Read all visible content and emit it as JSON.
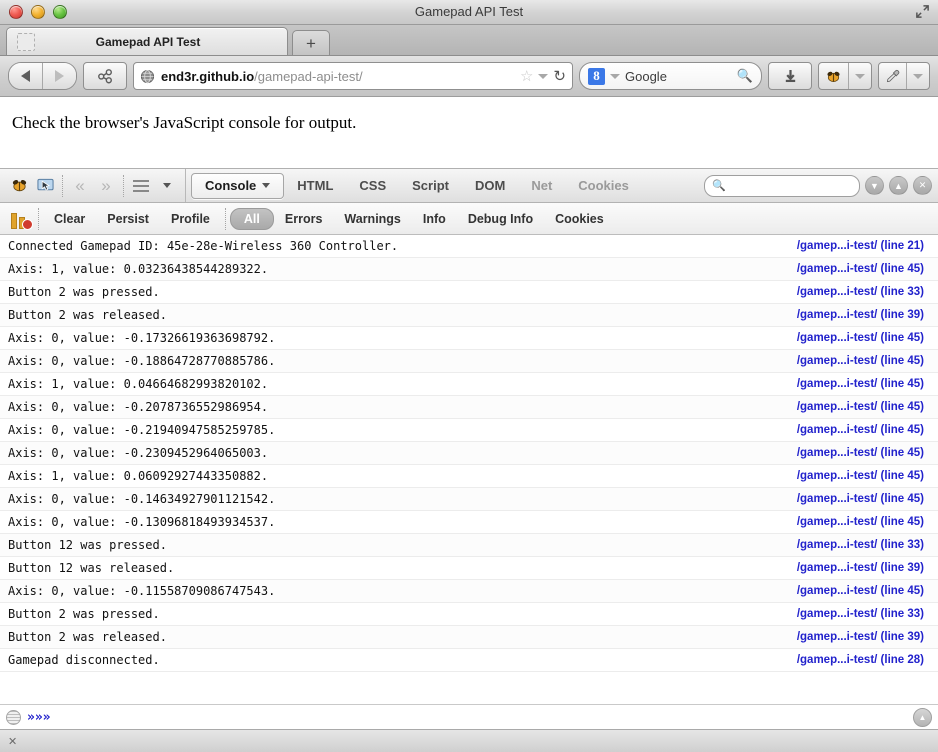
{
  "window": {
    "title": "Gamepad API Test",
    "fullscreen_icon": "fullscreen-icon"
  },
  "tabbar": {
    "tab_title": "Gamepad API Test",
    "new_tab_label": "+"
  },
  "navbar": {
    "back_icon": "back-arrow-icon",
    "forward_icon": "forward-arrow-icon",
    "share_icon": "share-icon",
    "url_domain": "end3r.github.io",
    "url_path": "/gamepad-api-test/",
    "star_icon": "star-icon",
    "reload_icon": "reload-icon",
    "search_engine": "Google",
    "search_engine_initial": "8",
    "search_placeholder": "Google",
    "download_icon": "download-arrow-icon",
    "firebug_icon": "firebug-bug-icon",
    "eyedropper_icon": "eyedropper-icon"
  },
  "page": {
    "body_text": "Check the browser's JavaScript console for output."
  },
  "firebug": {
    "toolbar_icons": [
      "firebug-bug-icon",
      "inspector-cursor-icon"
    ],
    "nav_back": "«",
    "nav_forward": "»",
    "panels": [
      {
        "label": "Console",
        "active": true,
        "dim": false,
        "has_caret": true
      },
      {
        "label": "HTML",
        "active": false,
        "dim": false,
        "has_caret": false
      },
      {
        "label": "CSS",
        "active": false,
        "dim": false,
        "has_caret": false
      },
      {
        "label": "Script",
        "active": false,
        "dim": false,
        "has_caret": false
      },
      {
        "label": "DOM",
        "active": false,
        "dim": false,
        "has_caret": false
      },
      {
        "label": "Net",
        "active": false,
        "dim": true,
        "has_caret": false
      },
      {
        "label": "Cookies",
        "active": false,
        "dim": true,
        "has_caret": false
      }
    ],
    "search_placeholder": "",
    "window_buttons": [
      "minimize-icon",
      "maximize-icon",
      "close-icon"
    ],
    "options": [
      {
        "label": "Clear",
        "pill": false
      },
      {
        "label": "Persist",
        "pill": false
      },
      {
        "label": "Profile",
        "pill": false
      },
      {
        "label": "All",
        "pill": true
      },
      {
        "label": "Errors",
        "pill": false
      },
      {
        "label": "Warnings",
        "pill": false
      },
      {
        "label": "Info",
        "pill": false
      },
      {
        "label": "Debug Info",
        "pill": false
      },
      {
        "label": "Cookies",
        "pill": false
      }
    ],
    "log": [
      {
        "message": "Connected Gamepad ID: 45e-28e-Wireless 360 Controller.",
        "source": "/gamep...i-test/ (line 21)"
      },
      {
        "message": "Axis: 1, value: 0.03236438544289322.",
        "source": "/gamep...i-test/ (line 45)"
      },
      {
        "message": "Button 2 was pressed.",
        "source": "/gamep...i-test/ (line 33)"
      },
      {
        "message": "Button 2 was released.",
        "source": "/gamep...i-test/ (line 39)"
      },
      {
        "message": "Axis: 0, value: -0.17326619363698792.",
        "source": "/gamep...i-test/ (line 45)"
      },
      {
        "message": "Axis: 0, value: -0.18864728770885786.",
        "source": "/gamep...i-test/ (line 45)"
      },
      {
        "message": "Axis: 1, value: 0.04664682993820102.",
        "source": "/gamep...i-test/ (line 45)"
      },
      {
        "message": "Axis: 0, value: -0.2078736552986954.",
        "source": "/gamep...i-test/ (line 45)"
      },
      {
        "message": "Axis: 0, value: -0.21940947585259785.",
        "source": "/gamep...i-test/ (line 45)"
      },
      {
        "message": "Axis: 0, value: -0.2309452964065003.",
        "source": "/gamep...i-test/ (line 45)"
      },
      {
        "message": "Axis: 1, value: 0.06092927443350882.",
        "source": "/gamep...i-test/ (line 45)"
      },
      {
        "message": "Axis: 0, value: -0.14634927901121542.",
        "source": "/gamep...i-test/ (line 45)"
      },
      {
        "message": "Axis: 0, value: -0.13096818493934537.",
        "source": "/gamep...i-test/ (line 45)"
      },
      {
        "message": "Button 12 was pressed.",
        "source": "/gamep...i-test/ (line 33)"
      },
      {
        "message": "Button 12 was released.",
        "source": "/gamep...i-test/ (line 39)"
      },
      {
        "message": "Axis: 0, value: -0.11558709086747543.",
        "source": "/gamep...i-test/ (line 45)"
      },
      {
        "message": "Button 2 was pressed.",
        "source": "/gamep...i-test/ (line 33)"
      },
      {
        "message": "Button 2 was released.",
        "source": "/gamep...i-test/ (line 39)"
      },
      {
        "message": "Gamepad disconnected.",
        "source": "/gamep...i-test/ (line 28)"
      }
    ],
    "command_line": {
      "prompt": "»»»",
      "value": "",
      "menu_icon": "command-menu-icon",
      "expand_icon": "expand-up-icon"
    }
  },
  "statusbar": {
    "close_label": "✕"
  },
  "colors": {
    "link": "#2222cc",
    "accent": "#3b78e7"
  }
}
